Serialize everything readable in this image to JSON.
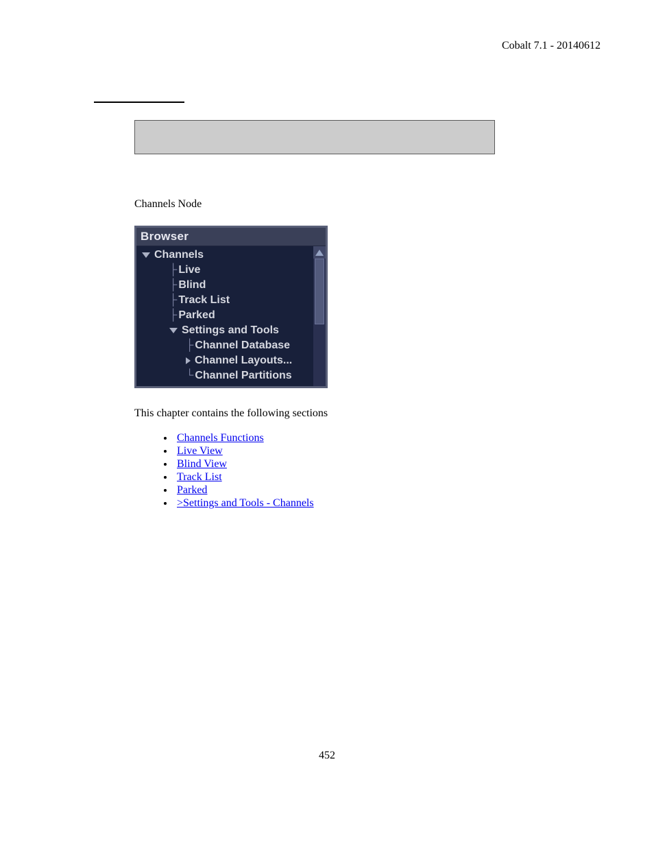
{
  "header": {
    "right_text": "Cobalt 7.1 - 20140612"
  },
  "caption": "Channels Node",
  "browser": {
    "title": "Browser",
    "tree": {
      "root": "Channels",
      "items": [
        "Live",
        "Blind",
        "Track List",
        "Parked"
      ],
      "sub": {
        "label": "Settings and Tools",
        "items": [
          "Channel Database",
          "Channel Layouts...",
          "Channel Partitions"
        ]
      }
    }
  },
  "intro": "This chapter contains the following sections",
  "links": [
    "Channels Functions",
    "Live View",
    "Blind View",
    "Track List",
    "Parked",
    ">Settings and Tools - Channels"
  ],
  "page_number": "452"
}
